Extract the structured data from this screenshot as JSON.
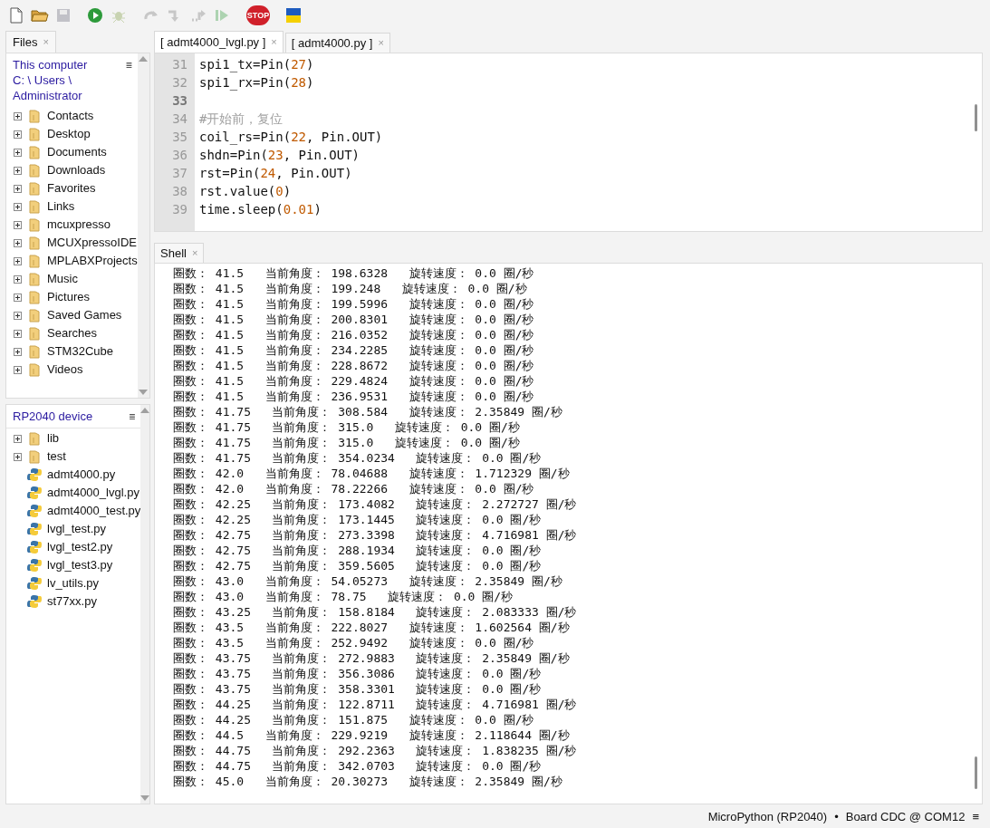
{
  "toolbar": [
    {
      "kind": "new",
      "disabled": false
    },
    {
      "kind": "open",
      "disabled": false
    },
    {
      "kind": "save",
      "disabled": true
    },
    {
      "kind": "run",
      "disabled": false
    },
    {
      "kind": "debug",
      "disabled": true
    },
    {
      "kind": "step_over",
      "disabled": true
    },
    {
      "kind": "step_into",
      "disabled": true
    },
    {
      "kind": "step_out",
      "disabled": true
    },
    {
      "kind": "resume",
      "disabled": true
    },
    {
      "kind": "stop",
      "disabled": false,
      "label": "STOP"
    },
    {
      "kind": "flag",
      "disabled": false
    }
  ],
  "files_panel": {
    "tab": "Files",
    "close": "×",
    "computer": {
      "path": [
        "This computer",
        "C: \\ Users \\",
        "Administrator"
      ],
      "menu": "≡",
      "items": [
        {
          "kind": "folder",
          "name": "Contacts",
          "expandable": true
        },
        {
          "kind": "folder",
          "name": "Desktop",
          "expandable": true
        },
        {
          "kind": "folder",
          "name": "Documents",
          "expandable": true
        },
        {
          "kind": "folder",
          "name": "Downloads",
          "expandable": true
        },
        {
          "kind": "folder",
          "name": "Favorites",
          "expandable": true
        },
        {
          "kind": "folder",
          "name": "Links",
          "expandable": true
        },
        {
          "kind": "folder",
          "name": "mcuxpresso",
          "expandable": true
        },
        {
          "kind": "folder",
          "name": "MCUXpressoIDE",
          "expandable": true
        },
        {
          "kind": "folder",
          "name": "MPLABXProjects",
          "expandable": true
        },
        {
          "kind": "folder",
          "name": "Music",
          "expandable": true
        },
        {
          "kind": "folder",
          "name": "Pictures",
          "expandable": true
        },
        {
          "kind": "folder",
          "name": "Saved Games",
          "expandable": true
        },
        {
          "kind": "folder",
          "name": "Searches",
          "expandable": true
        },
        {
          "kind": "folder",
          "name": "STM32Cube",
          "expandable": true
        },
        {
          "kind": "folder",
          "name": "Videos",
          "expandable": true
        }
      ]
    },
    "device": {
      "title": "RP2040 device",
      "menu": "≡",
      "items": [
        {
          "kind": "folder",
          "name": "lib",
          "expandable": true
        },
        {
          "kind": "folder",
          "name": "test",
          "expandable": true
        },
        {
          "kind": "python",
          "name": "admt4000.py",
          "expandable": false
        },
        {
          "kind": "python",
          "name": "admt4000_lvgl.py",
          "expandable": false
        },
        {
          "kind": "python",
          "name": "admt4000_test.py",
          "expandable": false
        },
        {
          "kind": "python",
          "name": "lvgl_test.py",
          "expandable": false
        },
        {
          "kind": "python",
          "name": "lvgl_test2.py",
          "expandable": false
        },
        {
          "kind": "python",
          "name": "lvgl_test3.py",
          "expandable": false
        },
        {
          "kind": "python",
          "name": "lv_utils.py",
          "expandable": false
        },
        {
          "kind": "python",
          "name": "st77xx.py",
          "expandable": false
        }
      ]
    }
  },
  "editor": {
    "tabs": [
      {
        "label": "[ admt4000_lvgl.py ]",
        "selected": true,
        "close": "×"
      },
      {
        "label": "[ admt4000.py ]",
        "selected": false,
        "close": "×"
      }
    ],
    "lines": [
      {
        "number": "31",
        "current": false,
        "tokens": [
          {
            "kind": "plain",
            "text": "spi1_tx=Pin("
          },
          {
            "kind": "number",
            "text": "27"
          },
          {
            "kind": "plain",
            "text": ")"
          }
        ]
      },
      {
        "number": "32",
        "current": false,
        "tokens": [
          {
            "kind": "plain",
            "text": "spi1_rx=Pin("
          },
          {
            "kind": "number",
            "text": "28"
          },
          {
            "kind": "plain",
            "text": ")"
          }
        ]
      },
      {
        "number": "33",
        "current": true
      },
      {
        "number": "34",
        "current": false,
        "tokens": [
          {
            "kind": "comment",
            "text": "#开始前，复位"
          }
        ]
      },
      {
        "number": "35",
        "current": false,
        "tokens": [
          {
            "kind": "plain",
            "text": "coil_rs=Pin("
          },
          {
            "kind": "number",
            "text": "22"
          },
          {
            "kind": "plain",
            "text": ", Pin.OUT)"
          }
        ]
      },
      {
        "number": "36",
        "current": false,
        "tokens": [
          {
            "kind": "plain",
            "text": "shdn=Pin("
          },
          {
            "kind": "number",
            "text": "23"
          },
          {
            "kind": "plain",
            "text": ", Pin.OUT)"
          }
        ]
      },
      {
        "number": "37",
        "current": false,
        "tokens": [
          {
            "kind": "plain",
            "text": "rst=Pin("
          },
          {
            "kind": "number",
            "text": "24"
          },
          {
            "kind": "plain",
            "text": ", Pin.OUT)"
          }
        ]
      },
      {
        "number": "38",
        "current": false,
        "tokens": [
          {
            "kind": "plain",
            "text": "rst.value("
          },
          {
            "kind": "number",
            "text": "0"
          },
          {
            "kind": "plain",
            "text": ")"
          }
        ]
      },
      {
        "number": "39",
        "current": false,
        "tokens": [
          {
            "kind": "plain",
            "text": "time.sleep("
          },
          {
            "kind": "number",
            "text": "0.01"
          },
          {
            "kind": "plain",
            "text": ")"
          }
        ]
      }
    ]
  },
  "shell": {
    "tab": "Shell",
    "close": "×",
    "lines": [
      "圈数： 41.5   当前角度： 198.6328   旋转速度： 0.0 圈/秒",
      "圈数： 41.5   当前角度： 199.248   旋转速度： 0.0 圈/秒",
      "圈数： 41.5   当前角度： 199.5996   旋转速度： 0.0 圈/秒",
      "圈数： 41.5   当前角度： 200.8301   旋转速度： 0.0 圈/秒",
      "圈数： 41.5   当前角度： 216.0352   旋转速度： 0.0 圈/秒",
      "圈数： 41.5   当前角度： 234.2285   旋转速度： 0.0 圈/秒",
      "圈数： 41.5   当前角度： 228.8672   旋转速度： 0.0 圈/秒",
      "圈数： 41.5   当前角度： 229.4824   旋转速度： 0.0 圈/秒",
      "圈数： 41.5   当前角度： 236.9531   旋转速度： 0.0 圈/秒",
      "圈数： 41.75   当前角度： 308.584   旋转速度： 2.35849 圈/秒",
      "圈数： 41.75   当前角度： 315.0   旋转速度： 0.0 圈/秒",
      "圈数： 41.75   当前角度： 315.0   旋转速度： 0.0 圈/秒",
      "圈数： 41.75   当前角度： 354.0234   旋转速度： 0.0 圈/秒",
      "圈数： 42.0   当前角度： 78.04688   旋转速度： 1.712329 圈/秒",
      "圈数： 42.0   当前角度： 78.22266   旋转速度： 0.0 圈/秒",
      "圈数： 42.25   当前角度： 173.4082   旋转速度： 2.272727 圈/秒",
      "圈数： 42.25   当前角度： 173.1445   旋转速度： 0.0 圈/秒",
      "圈数： 42.75   当前角度： 273.3398   旋转速度： 4.716981 圈/秒",
      "圈数： 42.75   当前角度： 288.1934   旋转速度： 0.0 圈/秒",
      "圈数： 42.75   当前角度： 359.5605   旋转速度： 0.0 圈/秒",
      "圈数： 43.0   当前角度： 54.05273   旋转速度： 2.35849 圈/秒",
      "圈数： 43.0   当前角度： 78.75   旋转速度： 0.0 圈/秒",
      "圈数： 43.25   当前角度： 158.8184   旋转速度： 2.083333 圈/秒",
      "圈数： 43.5   当前角度： 222.8027   旋转速度： 1.602564 圈/秒",
      "圈数： 43.5   当前角度： 252.9492   旋转速度： 0.0 圈/秒",
      "圈数： 43.75   当前角度： 272.9883   旋转速度： 2.35849 圈/秒",
      "圈数： 43.75   当前角度： 356.3086   旋转速度： 0.0 圈/秒",
      "圈数： 43.75   当前角度： 358.3301   旋转速度： 0.0 圈/秒",
      "圈数： 44.25   当前角度： 122.8711   旋转速度： 4.716981 圈/秒",
      "圈数： 44.25   当前角度： 151.875   旋转速度： 0.0 圈/秒",
      "圈数： 44.5   当前角度： 229.9219   旋转速度： 2.118644 圈/秒",
      "圈数： 44.75   当前角度： 292.2363   旋转速度： 1.838235 圈/秒",
      "圈数： 44.75   当前角度： 342.0703   旋转速度： 0.0 圈/秒",
      "圈数： 45.0   当前角度： 20.30273   旋转速度： 2.35849 圈/秒"
    ]
  },
  "status_bar": {
    "interpreter": "MicroPython (RP2040)",
    "separator": "•",
    "port": "Board CDC @ COM12",
    "menu": "≡"
  }
}
